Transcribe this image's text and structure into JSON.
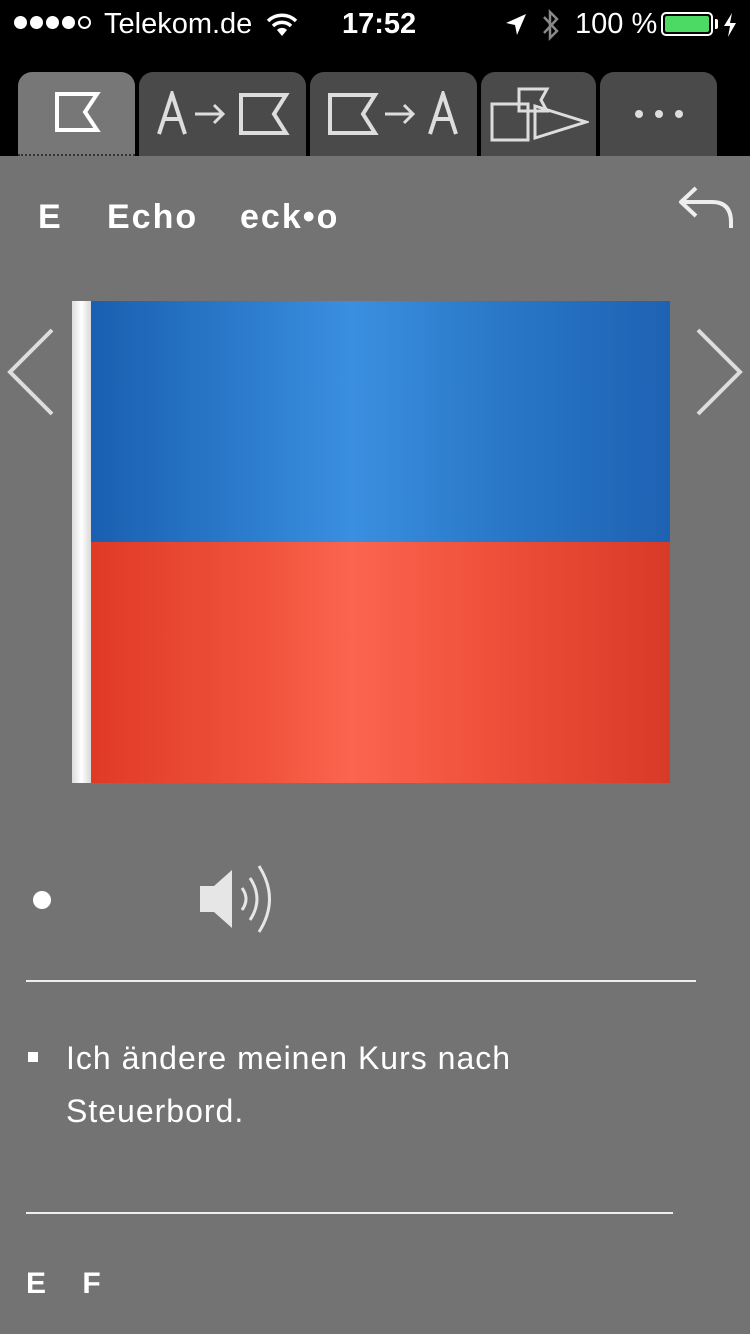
{
  "status_bar": {
    "carrier": "Telekom.de",
    "time": "17:52",
    "battery_percent": "100 %",
    "signal_bars_filled": 4,
    "signal_bars_total": 5,
    "battery_level": 1.0,
    "colors": {
      "battery": "#4cd964"
    }
  },
  "tabs": [
    {
      "name": "flag",
      "icon": "flag-icon",
      "active": true
    },
    {
      "name": "letter-to-flag",
      "icon": "letter-to-flag-icon",
      "label": "A→"
    },
    {
      "name": "flag-to-letter",
      "icon": "flag-to-letter-icon",
      "label": "→A"
    },
    {
      "name": "shapes",
      "icon": "shapes-icon"
    },
    {
      "name": "more",
      "icon": "more-icon",
      "label": "•••"
    }
  ],
  "header": {
    "letter": "E",
    "word": "Echo",
    "pronunciation": "eck•o",
    "back_icon": "undo-icon"
  },
  "navigation": {
    "prev_icon": "chevron-left-icon",
    "next_icon": "chevron-right-icon"
  },
  "flag": {
    "colors": {
      "top": "#2e7fd0",
      "bottom": "#f0533c",
      "pole": "#ffffff"
    }
  },
  "audio": {
    "icon": "speaker-icon"
  },
  "meaning": {
    "text": "Ich ändere meinen Kurs nach Steuerbord."
  },
  "footer": {
    "letters": "E F"
  }
}
